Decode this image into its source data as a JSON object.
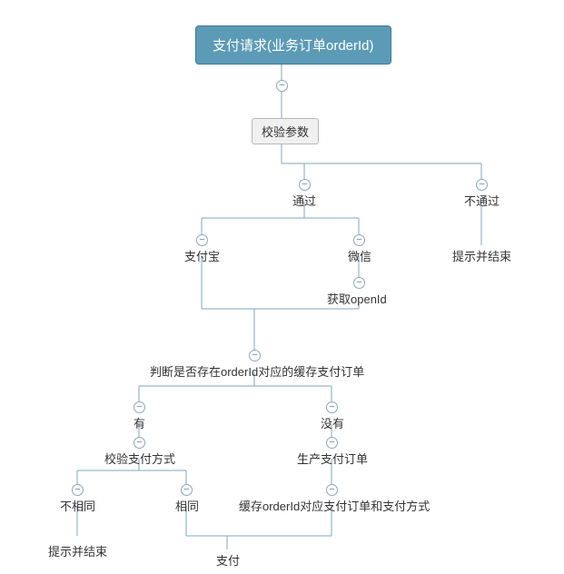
{
  "root": {
    "title": "支付请求(业务订单orderId)"
  },
  "nodes": {
    "validate_params": "校验参数",
    "pass": "通过",
    "fail": "不通过",
    "alipay": "支付宝",
    "wechat": "微信",
    "hint_end": "提示并结束",
    "get_openid": "获取openId",
    "check_cache": "判断是否存在orderId对应的缓存支付订单",
    "has": "有",
    "not_has": "没有",
    "validate_paytype": "校验支付方式",
    "create_order": "生产支付订单",
    "not_same": "不相同",
    "same": "相同",
    "cache_order": "缓存orderId对应支付订单和支付方式",
    "pay": "支付"
  },
  "colors": {
    "root_bg": "#5b9bb5",
    "root_border": "#3b7d99",
    "box_bg": "#f0f0f0",
    "box_border": "#b8b8b8",
    "line": "#7fa7bd",
    "text": "#333333"
  },
  "chart_data": {
    "type": "tree",
    "title": "支付请求(业务订单orderId)",
    "tree": {
      "label": "支付请求(业务订单orderId)",
      "children": [
        {
          "label": "校验参数",
          "children": [
            {
              "label": "通过",
              "children": [
                {
                  "label": "支付宝",
                  "merge_to": "判断是否存在orderId对应的缓存支付订单"
                },
                {
                  "label": "微信",
                  "children": [
                    {
                      "label": "获取openId",
                      "merge_to": "判断是否存在orderId对应的缓存支付订单"
                    }
                  ]
                }
              ],
              "merged_child": {
                "label": "判断是否存在orderId对应的缓存支付订单",
                "children": [
                  {
                    "label": "有",
                    "children": [
                      {
                        "label": "校验支付方式",
                        "children": [
                          {
                            "label": "不相同",
                            "children": [
                              {
                                "label": "提示并结束"
                              }
                            ]
                          },
                          {
                            "label": "相同",
                            "merge_to": "支付"
                          }
                        ]
                      }
                    ]
                  },
                  {
                    "label": "没有",
                    "children": [
                      {
                        "label": "生产支付订单",
                        "children": [
                          {
                            "label": "缓存orderId对应支付订单和支付方式",
                            "merge_to": "支付"
                          }
                        ]
                      }
                    ]
                  }
                ],
                "merged_child": {
                  "label": "支付"
                }
              }
            },
            {
              "label": "不通过",
              "children": [
                {
                  "label": "提示并结束"
                }
              ]
            }
          ]
        }
      ]
    }
  }
}
